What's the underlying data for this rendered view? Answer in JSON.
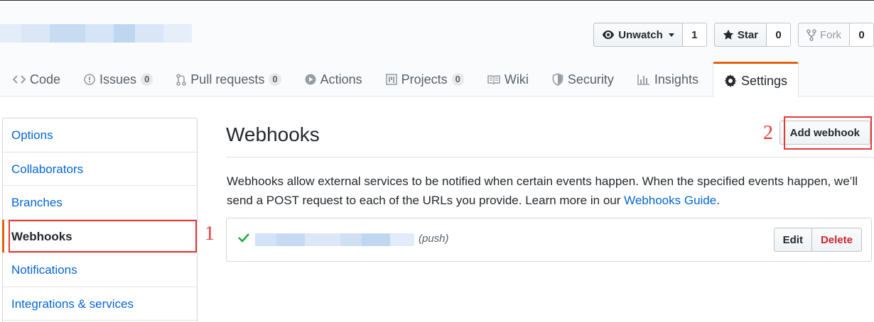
{
  "header": {
    "actions": {
      "watch": {
        "label": "Unwatch",
        "count": "1"
      },
      "star": {
        "label": "Star",
        "count": "0"
      },
      "fork": {
        "label": "Fork",
        "count": "0"
      }
    }
  },
  "tabs": [
    {
      "label": "Code",
      "icon": "code-icon"
    },
    {
      "label": "Issues",
      "icon": "issue-icon",
      "counter": "0"
    },
    {
      "label": "Pull requests",
      "icon": "pull-request-icon",
      "counter": "0"
    },
    {
      "label": "Actions",
      "icon": "play-icon"
    },
    {
      "label": "Projects",
      "icon": "project-icon",
      "counter": "0"
    },
    {
      "label": "Wiki",
      "icon": "book-icon"
    },
    {
      "label": "Security",
      "icon": "shield-icon"
    },
    {
      "label": "Insights",
      "icon": "graph-icon"
    },
    {
      "label": "Settings",
      "icon": "gear-icon",
      "selected": true
    }
  ],
  "sidebar": {
    "items": [
      {
        "label": "Options"
      },
      {
        "label": "Collaborators"
      },
      {
        "label": "Branches"
      },
      {
        "label": "Webhooks",
        "selected": true
      },
      {
        "label": "Notifications"
      },
      {
        "label": "Integrations & services"
      }
    ]
  },
  "annotations": {
    "first": "1",
    "second": "2"
  },
  "main": {
    "title": "Webhooks",
    "add_button": "Add webhook",
    "description_text": "Webhooks allow external services to be notified when certain events happen. When the specified events happen, we’ll send a POST request to each of the URLs you provide. Learn more in our ",
    "description_link": "Webhooks Guide",
    "description_end": ".",
    "hook": {
      "event": "(push)",
      "edit_label": "Edit",
      "delete_label": "Delete"
    }
  },
  "colors": {
    "accent": "#e36209",
    "link": "#0366d6",
    "annotation": "#e53935",
    "danger": "#cb2431",
    "success": "#28a745"
  }
}
